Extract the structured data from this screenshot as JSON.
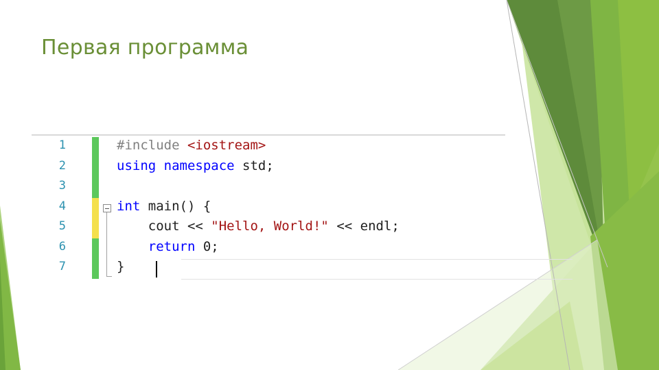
{
  "slide": {
    "title": "Первая программа"
  },
  "editor": {
    "line_numbers": [
      "1",
      "2",
      "3",
      "4",
      "5",
      "6",
      "7"
    ],
    "change_markers": [
      "saved",
      "saved",
      "saved",
      "unsaved",
      "unsaved",
      "saved",
      "saved"
    ],
    "code_tokens": [
      [
        {
          "t": "#include ",
          "c": "pp"
        },
        {
          "t": "<iostream>",
          "c": "str"
        }
      ],
      [
        {
          "t": "using",
          "c": "kw"
        },
        {
          "t": " ",
          "c": ""
        },
        {
          "t": "namespace",
          "c": "kw"
        },
        {
          "t": " std;",
          "c": ""
        }
      ],
      [],
      [
        {
          "t": "int",
          "c": "kw"
        },
        {
          "t": " main() {",
          "c": ""
        }
      ],
      [
        {
          "t": "    cout << ",
          "c": ""
        },
        {
          "t": "\"Hello, World!\"",
          "c": "str"
        },
        {
          "t": " << endl;",
          "c": ""
        }
      ],
      [
        {
          "t": "    ",
          "c": ""
        },
        {
          "t": "return",
          "c": "kw"
        },
        {
          "t": " 0;",
          "c": ""
        }
      ],
      [
        {
          "t": "}",
          "c": ""
        }
      ]
    ]
  },
  "colors": {
    "title_text": "#6a8f36",
    "line_number": "#2b91af",
    "keyword": "#0000ff",
    "preprocessor": "#808080",
    "string": "#a31515",
    "change_saved": "#5cc85c",
    "change_unsaved": "#f4e04d",
    "accent_dark_green": "#5d8d3e",
    "accent_light_green": "#a8d05a"
  }
}
